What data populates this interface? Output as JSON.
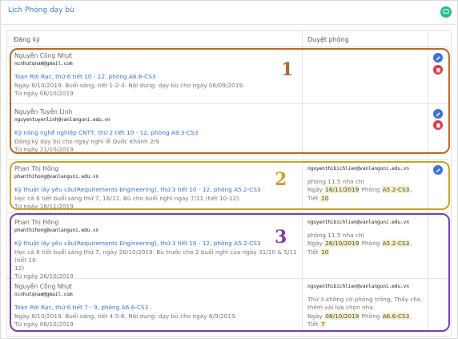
{
  "header": {
    "title": "Lịch Phòng dạy bù"
  },
  "table": {
    "col_register": "Đăng ký",
    "col_approved": "Duyệt phòng"
  },
  "rows": [
    {
      "name": "Nguyễn Công Nhựt",
      "email": "ncnhutqnam@gmail.com",
      "course": "Toán Rời Rạc, thứ 6 tiết 10 - 12, phòng A6.6-CS3",
      "details": [
        "Ngày 8/10/2019. Buổi sáng, tiết 1-2-3. Nội dung: dạy bù cho ngày 06/09/2019."
      ],
      "date": "Từ ngày 08/10/2019"
    },
    {
      "name": "Nguyễn Tuyền Linh",
      "email": "nguyentuyenlinh@vanlanguni.edu.vn",
      "course": "Kỹ năng nghề nghiệp CNTT, thứ 2 tiết 10 - 12, phòng A9.3-CS3",
      "details": [
        "Đăng ký dạy bù cho ngày nghỉ lễ Quốc Khánh 2/9"
      ],
      "date": "Từ ngày 21/10/2019"
    },
    {
      "name": "Phan Thị Hồng",
      "email": "phanthihong@vanlanguni.edu.vn",
      "course": "Kỹ thuật lấy yêu cầu(Requirements Engineering), thứ 3 tiết 10 - 12, phòng A5.2-CS3",
      "details": [
        "Học cả 6 tiết buổi sáng thứ 7, 16/11. Bù cho buổi nghỉ ngày 7/11 (tiết 10-12)."
      ],
      "date": "Từ ngày 16/11/2019",
      "approver": "nguyenthibichlien@vanlanguni.edu.vn",
      "note": "phòng 11.5 nha chị",
      "ngay_label": "Ngày",
      "ngay": "16/11/2019",
      "phong_label": "Phòng",
      "phong": "A5.2-CS3",
      "tiet_label": "Tiết",
      "tiet": "10"
    },
    {
      "name": "Phan Thị Hồng",
      "email": "phanthihong@vanlanguni.edu.vn",
      "course": "Kỹ thuật lấy yêu cầu(Requirements Engineering), thứ 3 tiết 10 - 12, phòng A5.2-CS3",
      "details": [
        "Học cả 6 tiết buổi sáng thứ 7, ngày 26/10/2019. Bù trước cho 2 buổi nghỉ của ngày 31/10 & 5/11 (tiết 10-",
        "12)"
      ],
      "date": "Từ ngày 26/10/2019",
      "approver": "nguyenthibichlien@vanlanguni.edu.vn",
      "note": "phòng 11.5 nha chị",
      "ngay_label": "Ngày",
      "ngay": "26/10/2019",
      "phong_label": "Phòng",
      "phong": "A5.2-CS3",
      "tiet_label": "Tiết",
      "tiet": "10"
    },
    {
      "name": "Nguyễn Công Nhựt",
      "email": "ncnhutqnam@gmail.com",
      "course": "Toán Rời Rạc, thứ 6 tiết 7 - 9, phòng A6.6-CS3",
      "details": [
        "Ngày 8/10/2019. Buổi sáng, tiết 4-5-6. Nội dung: dạy bù cho ngày 6/9/2019."
      ],
      "date": "Từ ngày 08/10/2019",
      "approver": "nguyenthibichlien@vanlanguni.edu.vn",
      "note": "Thứ 3 không có phòng trống, Thầy cho thêm vài lựa chọn nha.",
      "ngay_label": "Ngày",
      "ngay": "08/10/2019",
      "phong_label": "Phòng",
      "phong": "A6.6-CS3",
      "tiet_label": "Tiết",
      "tiet": "7"
    }
  ],
  "groups": [
    {
      "label": "1",
      "color": "#b8652f"
    },
    {
      "label": "2",
      "color": "#c9a32a"
    },
    {
      "label": "3",
      "color": "#7a3fa6"
    }
  ],
  "colors": {
    "link": "#3a6fd8",
    "edit": "#3b73d6",
    "delete": "#e03a4a",
    "chat": "#1dbf8c"
  }
}
